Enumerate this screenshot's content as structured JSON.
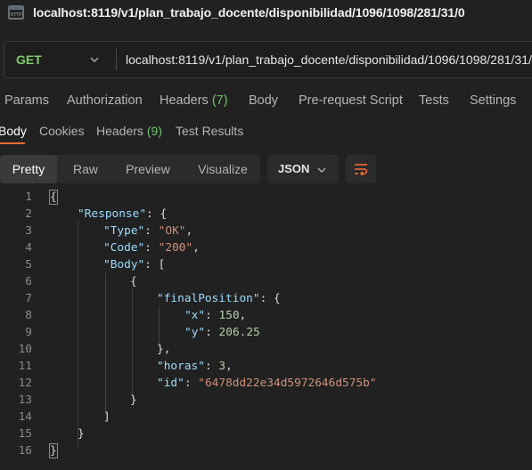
{
  "title": "localhost:8119/v1/plan_trabajo_docente/disponibilidad/1096/1098/281/31/0",
  "request": {
    "method": "GET",
    "url": "localhost:8119/v1/plan_trabajo_docente/disponibilidad/1096/1098/281/31/0"
  },
  "request_tabs": [
    "Params",
    "Authorization",
    "Headers",
    "(7)",
    "Body",
    "Pre-request Script",
    "Tests",
    "Settings"
  ],
  "response_tabs": {
    "body": "Body",
    "cookies": "Cookies",
    "headers": "Headers",
    "headers_count": "(9)",
    "test_results": "Test Results"
  },
  "view_modes": [
    "Pretty",
    "Raw",
    "Preview",
    "Visualize"
  ],
  "format": "JSON",
  "colors": {
    "accent": "#ff6c37",
    "method": "#7fcf6b",
    "key": "#9cdcfe",
    "string": "#ce9178",
    "number": "#b5cea8"
  },
  "icons": {
    "app": "http-icon",
    "method_dropdown": "chevron-down-icon",
    "format_dropdown": "chevron-down-icon",
    "wrap": "wrap-lines-icon"
  },
  "code": {
    "line_numbers": [
      "1",
      "2",
      "3",
      "4",
      "5",
      "6",
      "7",
      "8",
      "9",
      "10",
      "11",
      "12",
      "13",
      "14",
      "15",
      "16"
    ],
    "tokens": {
      "l1": "{",
      "l2k": "\"Response\"",
      "l2p": ": {",
      "l3k": "\"Type\"",
      "l3p": ": ",
      "l3v": "\"OK\"",
      "l3c": ",",
      "l4k": "\"Code\"",
      "l4p": ": ",
      "l4v": "\"200\"",
      "l4c": ",",
      "l5k": "\"Body\"",
      "l5p": ": [",
      "l6": "{",
      "l7k": "\"finalPosition\"",
      "l7p": ": {",
      "l8k": "\"x\"",
      "l8p": ": ",
      "l8v": "150",
      "l8c": ",",
      "l9k": "\"y\"",
      "l9p": ": ",
      "l9v": "206.25",
      "l10": "},",
      "l11k": "\"horas\"",
      "l11p": ": ",
      "l11v": "3",
      "l11c": ",",
      "l12k": "\"id\"",
      "l12p": ": ",
      "l12v": "\"6478dd22e34d5972646d575b\"",
      "l13": "}",
      "l14": "]",
      "l15": "}",
      "l16": "}"
    }
  }
}
